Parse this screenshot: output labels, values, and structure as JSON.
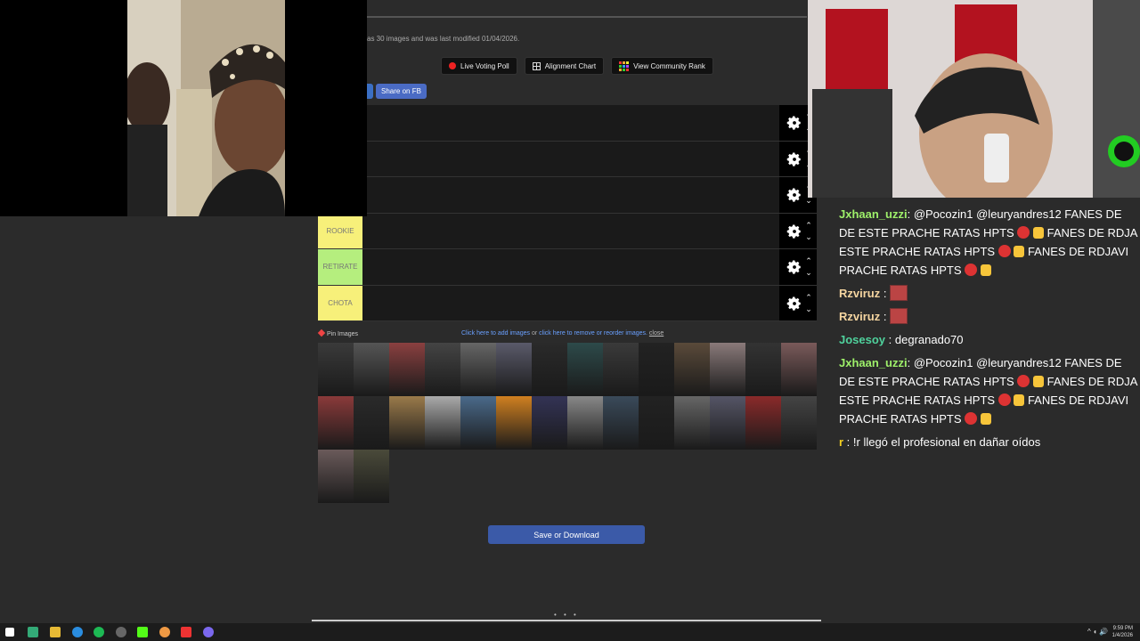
{
  "page": {
    "info_text": "as 30 images and was last modified 01/04/2026.",
    "buttons": {
      "live_voting_poll": "Live Voting Poll",
      "alignment_chart": "Alignment Chart",
      "view_community_rank": "View Community Rank",
      "share_fb": "Share on FB"
    },
    "tiers": [
      {
        "label": "",
        "color": "#1a1a1a"
      },
      {
        "label": "",
        "color": "#1a1a1a"
      },
      {
        "label": "",
        "color": "#1a1a1a"
      },
      {
        "label": "ROOKIE",
        "color": "#f7f07a"
      },
      {
        "label": "RETIRATE",
        "color": "#b5ee7e"
      },
      {
        "label": "CHOTA",
        "color": "#f7f07a"
      }
    ],
    "pin_images": "Pin Images",
    "add_images": {
      "click_add": "Click here to add images",
      "or": " or ",
      "click_remove": "click here to remove or reorder images.",
      "close": "close"
    },
    "thumb_colors": [
      "#3a3a3a",
      "#555",
      "#8a4040",
      "#444",
      "#666",
      "#5a5a6a",
      "#2a2a2a",
      "#2d4a4a",
      "#3a3a3a",
      "#222",
      "#5a4a3a",
      "#8a7a7a",
      "#333",
      "#7a5a5a",
      "#8a3a3a",
      "#2a2a2a",
      "#9a7a4a",
      "#aaa",
      "#4a6a8a",
      "#d08020",
      "#335",
      "#888",
      "#3a4a5a",
      "#222",
      "#666",
      "#556",
      "#8a2a2a",
      "#444",
      "#6a5a5a",
      "#4a4a3a"
    ],
    "save_button": "Save or Download",
    "pager": "• • •"
  },
  "chat": [
    {
      "user": "Jxhaan_uzzi",
      "color": "#9ef06a",
      "text": ": @Pocozin1 @leuryandres12 FANES DE DE ESTE PRACHE RATAS HPTS",
      "text2": "FANES DE RDJA ESTE PRACHE RATAS HPTS",
      "text3": "FANES DE RDJAVI PRACHE RATAS HPTS",
      "kind": "spam"
    },
    {
      "user": "Rzviruz",
      "color": "#f5d5a0",
      "text": " :",
      "kind": "emote"
    },
    {
      "user": "Rzviruz",
      "color": "#f5d5a0",
      "text": " :",
      "kind": "emote"
    },
    {
      "user": "Josesoy",
      "color": "#4fd19c",
      "text": " : degranado70",
      "kind": "plain"
    },
    {
      "user": "Jxhaan_uzzi",
      "color": "#9ef06a",
      "text": ": @Pocozin1 @leuryandres12 FANES DE DE ESTE PRACHE RATAS HPTS",
      "text2": "FANES DE RDJA ESTE PRACHE RATAS HPTS",
      "text3": "FANES DE RDJAVI PRACHE RATAS HPTS",
      "kind": "spam"
    },
    {
      "user": "r",
      "color": "#f5d020",
      "text": " : !r llegó el profesional en dañar oídos",
      "kind": "plain"
    }
  ],
  "taskbar": {
    "tray": "^ ◖ 🔊",
    "time": "9:59 PM",
    "date": "1/4/2026"
  }
}
